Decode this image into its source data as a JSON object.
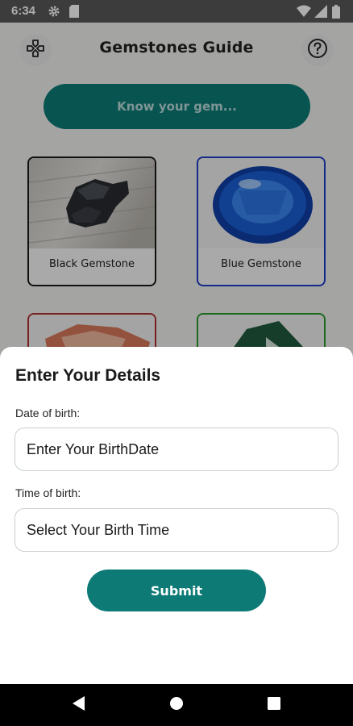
{
  "status_bar": {
    "time": "6:34"
  },
  "header": {
    "title": "Gemstones Guide"
  },
  "know_button": {
    "label": "Know your gem..."
  },
  "gem_cards": [
    {
      "label": "Black Gemstone",
      "accent": "#1a1a1a"
    },
    {
      "label": "Blue Gemstone",
      "accent": "#1d3ec7"
    },
    {
      "label": "",
      "accent": "#b03030"
    },
    {
      "label": "",
      "accent": "#2a9a2a"
    }
  ],
  "details_sheet": {
    "title": "Enter Your Details",
    "dob_label": "Date of birth:",
    "dob_placeholder": "Enter Your BirthDate",
    "tob_label": "Time of birth:",
    "tob_placeholder": "Select Your Birth Time",
    "submit_label": "Submit"
  },
  "colors": {
    "primary": "#0d7a76",
    "status_bar": "#595959"
  },
  "icons": [
    "gamepad-icon",
    "help-circle-icon",
    "settings-icon",
    "sim-card-icon",
    "wifi-icon",
    "signal-icon",
    "battery-icon",
    "back-icon",
    "home-icon",
    "recents-icon"
  ]
}
